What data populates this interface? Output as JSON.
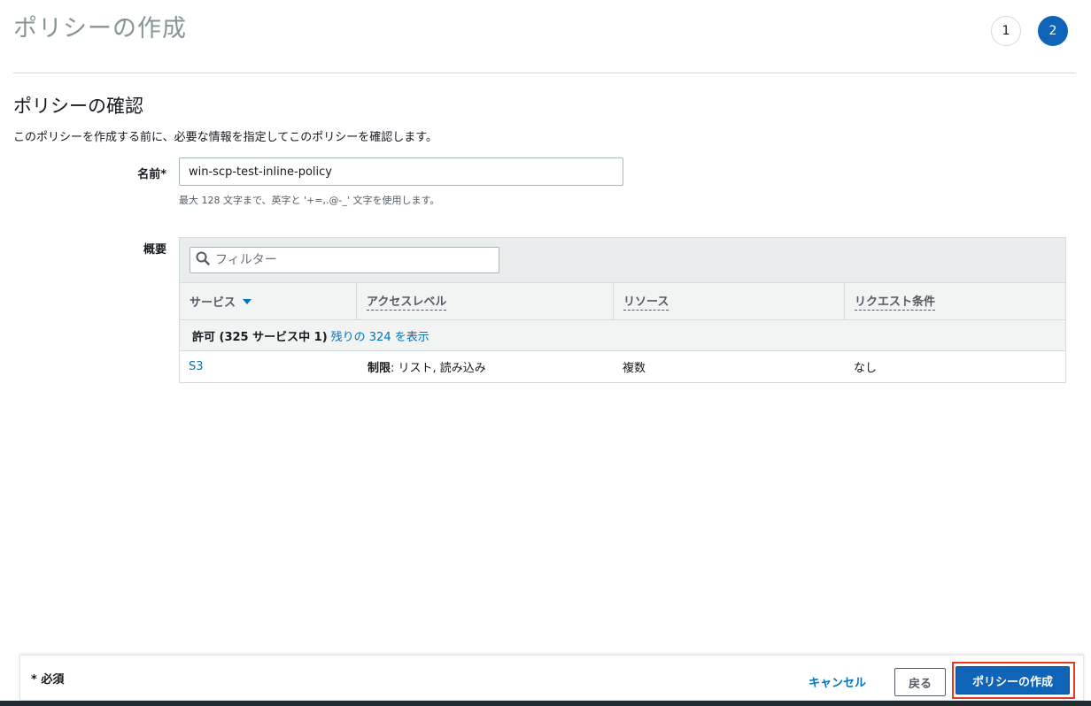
{
  "page_title": "ポリシーの作成",
  "steps": [
    "1",
    "2"
  ],
  "active_step": "2",
  "section": {
    "title": "ポリシーの確認",
    "description": "このポリシーを作成する前に、必要な情報を指定してこのポリシーを確認します。"
  },
  "name_field": {
    "label": "名前*",
    "value": "win-scp-test-inline-policy",
    "hint": "最大 128 文字まで、英字と '+=,.@-_' 文字を使用します。"
  },
  "summary": {
    "label": "概要",
    "filter_placeholder": "フィルター",
    "columns": [
      "サービス",
      "アクセスレベル",
      "リソース",
      "リクエスト条件"
    ],
    "group": {
      "label": "許可 (325 サービス中 1)",
      "link": "残りの 324 を表示"
    },
    "rows": [
      {
        "service": "S3",
        "access_prefix": "制限",
        "access_rest": ": リスト, 読み込み",
        "resource": "複数",
        "condition": "なし"
      }
    ]
  },
  "footer": {
    "required_note": "* 必須",
    "cancel_label": "キャンセル",
    "back_label": "戻る",
    "create_label": "ポリシーの作成"
  },
  "colors": {
    "primary": "#0f64b8",
    "link": "#0073bb",
    "highlight": "#e8381f"
  }
}
